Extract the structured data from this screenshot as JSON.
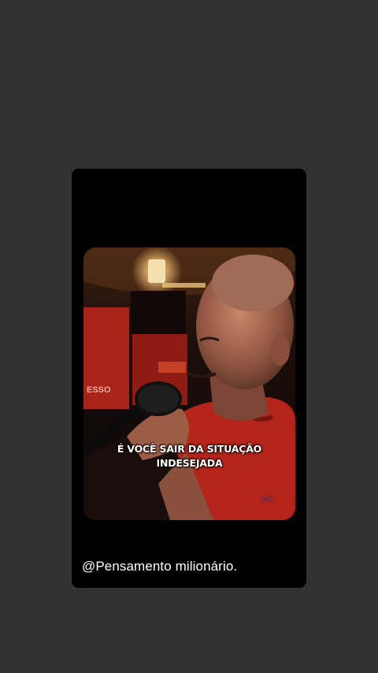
{
  "story": {
    "caption_lines": [
      "É VOCÊ SAIR DA SITUAÇÃO",
      "INDESEJADA"
    ],
    "username": "@Pensamento milionário."
  },
  "colors": {
    "background": "#323232",
    "card": "#000000",
    "shirt": "#b5241a",
    "studio_red": "#c0281c"
  },
  "icons": [
    "microphone-icon",
    "shirt-logo-icon"
  ]
}
